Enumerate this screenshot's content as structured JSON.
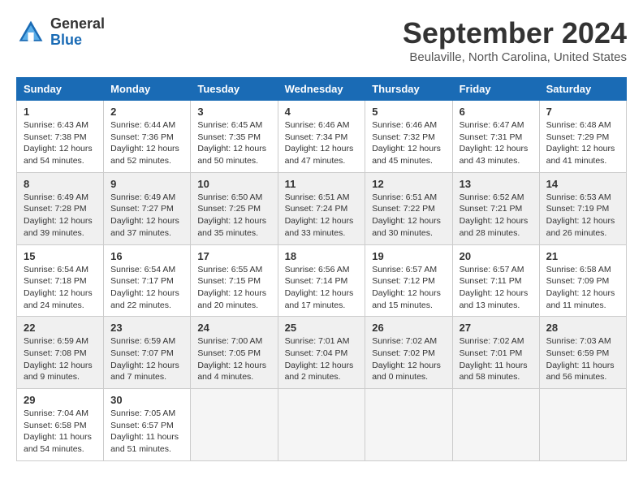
{
  "header": {
    "logo_general": "General",
    "logo_blue": "Blue",
    "month_year": "September 2024",
    "location": "Beulaville, North Carolina, United States"
  },
  "weekdays": [
    "Sunday",
    "Monday",
    "Tuesday",
    "Wednesday",
    "Thursday",
    "Friday",
    "Saturday"
  ],
  "weeks": [
    [
      {
        "day": "1",
        "info": "Sunrise: 6:43 AM\nSunset: 7:38 PM\nDaylight: 12 hours\nand 54 minutes."
      },
      {
        "day": "2",
        "info": "Sunrise: 6:44 AM\nSunset: 7:36 PM\nDaylight: 12 hours\nand 52 minutes."
      },
      {
        "day": "3",
        "info": "Sunrise: 6:45 AM\nSunset: 7:35 PM\nDaylight: 12 hours\nand 50 minutes."
      },
      {
        "day": "4",
        "info": "Sunrise: 6:46 AM\nSunset: 7:34 PM\nDaylight: 12 hours\nand 47 minutes."
      },
      {
        "day": "5",
        "info": "Sunrise: 6:46 AM\nSunset: 7:32 PM\nDaylight: 12 hours\nand 45 minutes."
      },
      {
        "day": "6",
        "info": "Sunrise: 6:47 AM\nSunset: 7:31 PM\nDaylight: 12 hours\nand 43 minutes."
      },
      {
        "day": "7",
        "info": "Sunrise: 6:48 AM\nSunset: 7:29 PM\nDaylight: 12 hours\nand 41 minutes."
      }
    ],
    [
      {
        "day": "8",
        "info": "Sunrise: 6:49 AM\nSunset: 7:28 PM\nDaylight: 12 hours\nand 39 minutes."
      },
      {
        "day": "9",
        "info": "Sunrise: 6:49 AM\nSunset: 7:27 PM\nDaylight: 12 hours\nand 37 minutes."
      },
      {
        "day": "10",
        "info": "Sunrise: 6:50 AM\nSunset: 7:25 PM\nDaylight: 12 hours\nand 35 minutes."
      },
      {
        "day": "11",
        "info": "Sunrise: 6:51 AM\nSunset: 7:24 PM\nDaylight: 12 hours\nand 33 minutes."
      },
      {
        "day": "12",
        "info": "Sunrise: 6:51 AM\nSunset: 7:22 PM\nDaylight: 12 hours\nand 30 minutes."
      },
      {
        "day": "13",
        "info": "Sunrise: 6:52 AM\nSunset: 7:21 PM\nDaylight: 12 hours\nand 28 minutes."
      },
      {
        "day": "14",
        "info": "Sunrise: 6:53 AM\nSunset: 7:19 PM\nDaylight: 12 hours\nand 26 minutes."
      }
    ],
    [
      {
        "day": "15",
        "info": "Sunrise: 6:54 AM\nSunset: 7:18 PM\nDaylight: 12 hours\nand 24 minutes."
      },
      {
        "day": "16",
        "info": "Sunrise: 6:54 AM\nSunset: 7:17 PM\nDaylight: 12 hours\nand 22 minutes."
      },
      {
        "day": "17",
        "info": "Sunrise: 6:55 AM\nSunset: 7:15 PM\nDaylight: 12 hours\nand 20 minutes."
      },
      {
        "day": "18",
        "info": "Sunrise: 6:56 AM\nSunset: 7:14 PM\nDaylight: 12 hours\nand 17 minutes."
      },
      {
        "day": "19",
        "info": "Sunrise: 6:57 AM\nSunset: 7:12 PM\nDaylight: 12 hours\nand 15 minutes."
      },
      {
        "day": "20",
        "info": "Sunrise: 6:57 AM\nSunset: 7:11 PM\nDaylight: 12 hours\nand 13 minutes."
      },
      {
        "day": "21",
        "info": "Sunrise: 6:58 AM\nSunset: 7:09 PM\nDaylight: 12 hours\nand 11 minutes."
      }
    ],
    [
      {
        "day": "22",
        "info": "Sunrise: 6:59 AM\nSunset: 7:08 PM\nDaylight: 12 hours\nand 9 minutes."
      },
      {
        "day": "23",
        "info": "Sunrise: 6:59 AM\nSunset: 7:07 PM\nDaylight: 12 hours\nand 7 minutes."
      },
      {
        "day": "24",
        "info": "Sunrise: 7:00 AM\nSunset: 7:05 PM\nDaylight: 12 hours\nand 4 minutes."
      },
      {
        "day": "25",
        "info": "Sunrise: 7:01 AM\nSunset: 7:04 PM\nDaylight: 12 hours\nand 2 minutes."
      },
      {
        "day": "26",
        "info": "Sunrise: 7:02 AM\nSunset: 7:02 PM\nDaylight: 12 hours\nand 0 minutes."
      },
      {
        "day": "27",
        "info": "Sunrise: 7:02 AM\nSunset: 7:01 PM\nDaylight: 11 hours\nand 58 minutes."
      },
      {
        "day": "28",
        "info": "Sunrise: 7:03 AM\nSunset: 6:59 PM\nDaylight: 11 hours\nand 56 minutes."
      }
    ],
    [
      {
        "day": "29",
        "info": "Sunrise: 7:04 AM\nSunset: 6:58 PM\nDaylight: 11 hours\nand 54 minutes."
      },
      {
        "day": "30",
        "info": "Sunrise: 7:05 AM\nSunset: 6:57 PM\nDaylight: 11 hours\nand 51 minutes."
      },
      {
        "day": "",
        "info": ""
      },
      {
        "day": "",
        "info": ""
      },
      {
        "day": "",
        "info": ""
      },
      {
        "day": "",
        "info": ""
      },
      {
        "day": "",
        "info": ""
      }
    ]
  ]
}
